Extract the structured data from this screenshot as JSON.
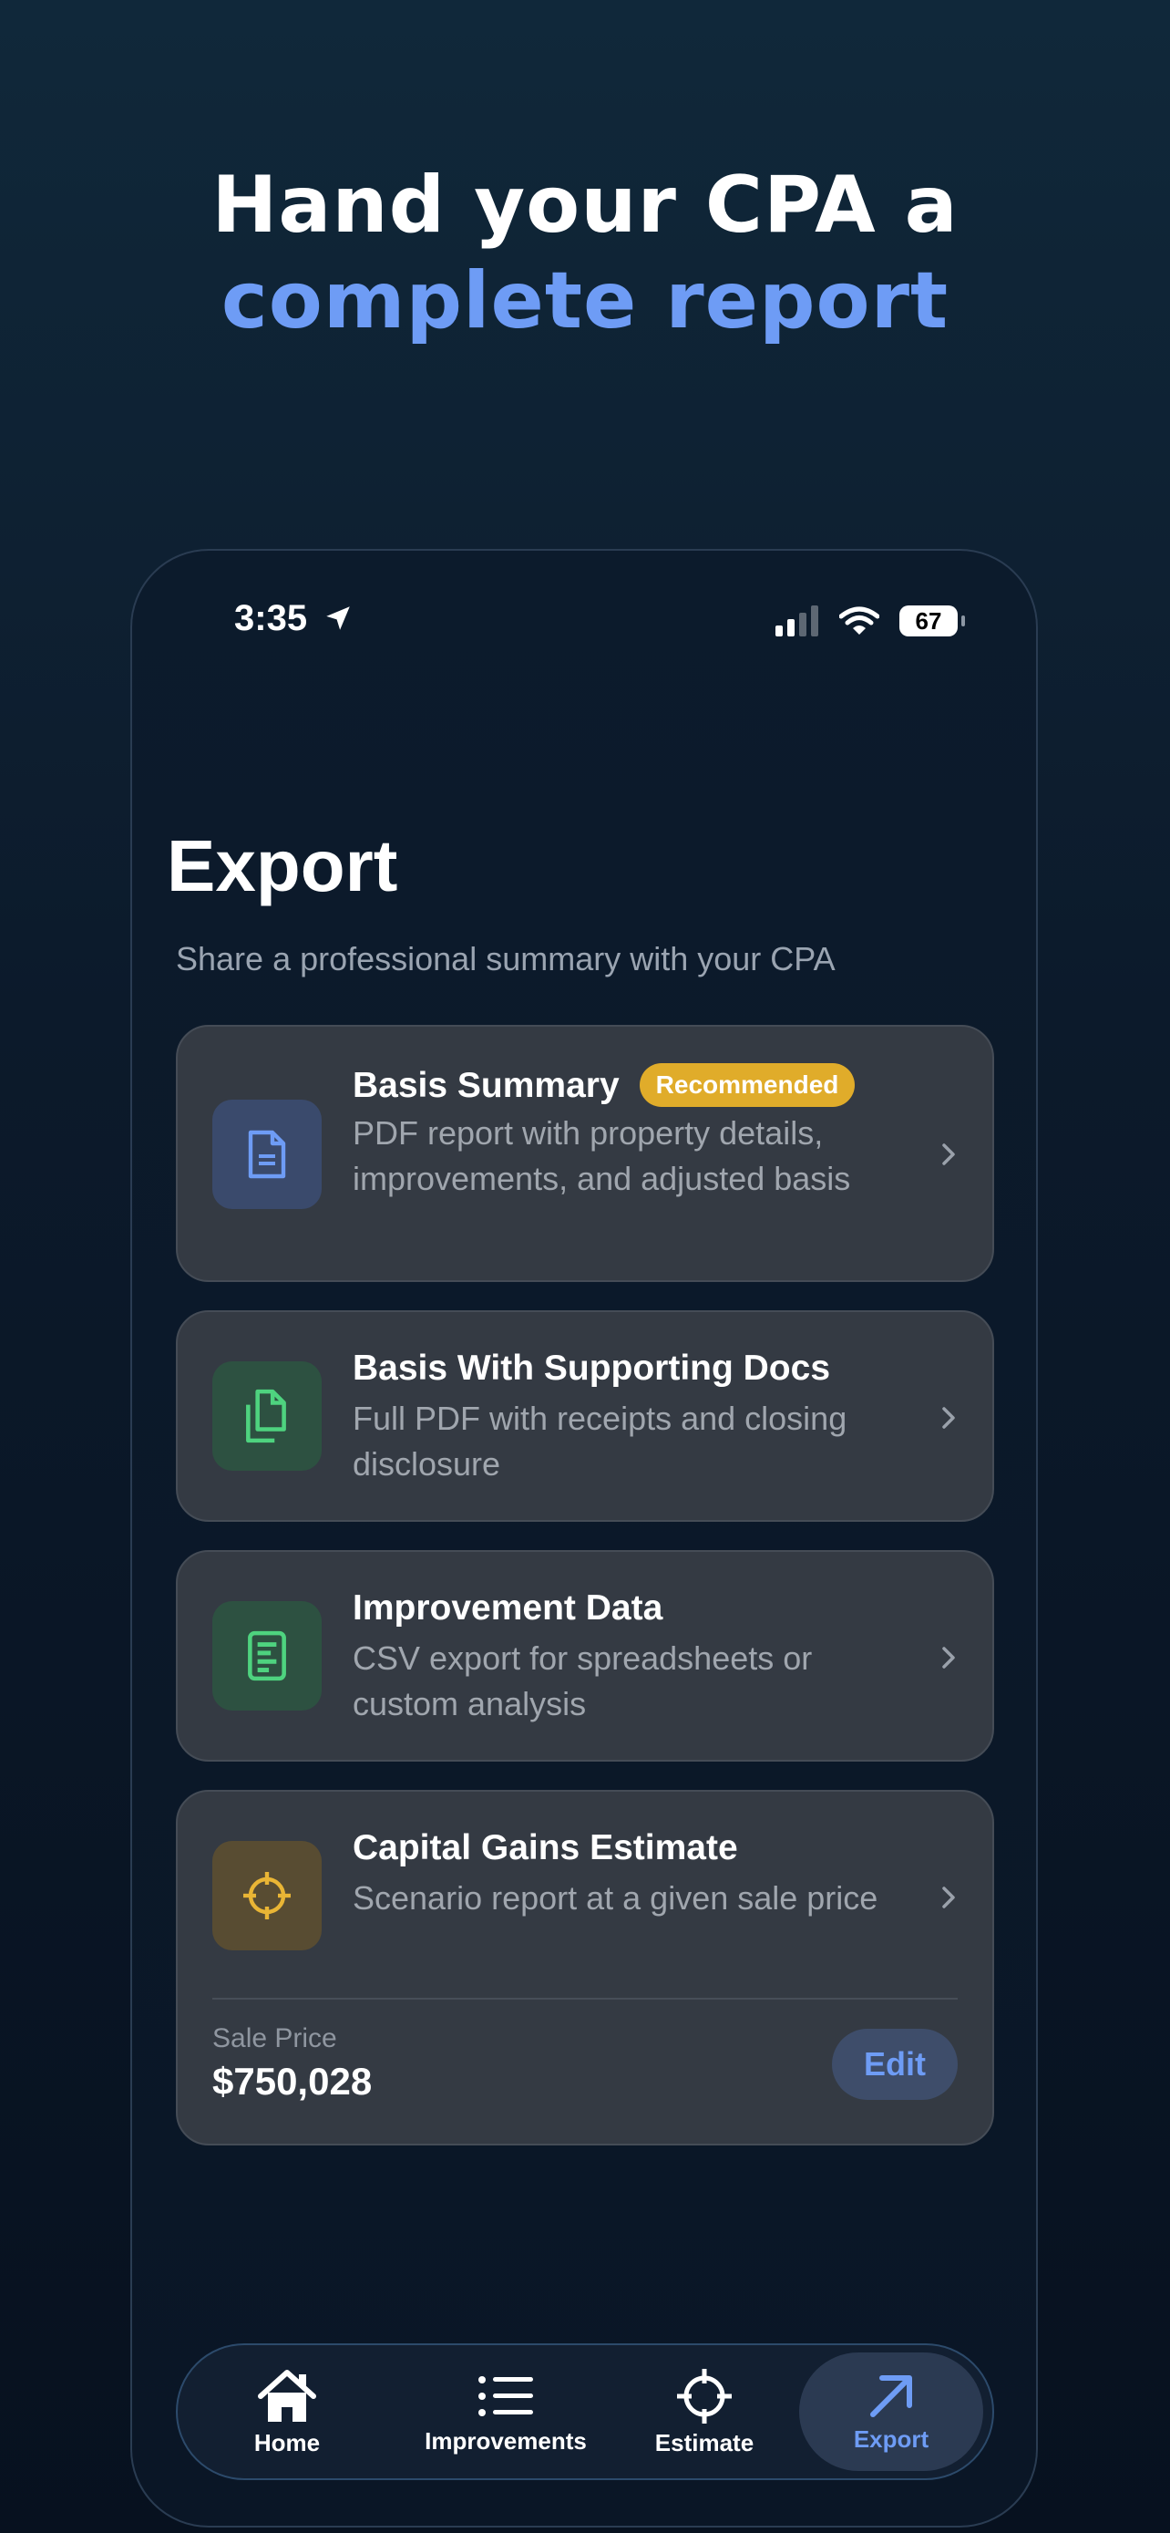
{
  "headline": {
    "line1": "Hand your CPA a",
    "line2": "complete report"
  },
  "status_bar": {
    "time": "3:35",
    "battery": "67"
  },
  "page": {
    "title": "Export",
    "subtitle": "Share a professional summary with your CPA"
  },
  "options": [
    {
      "title": "Basis Summary",
      "badge": "Recommended",
      "desc": "PDF report with property details, improvements, and adjusted basis",
      "icon": "document-icon",
      "color": "#6e9cf5"
    },
    {
      "title": "Basis With Supporting Docs",
      "desc": "Full PDF with receipts and closing disclosure",
      "icon": "documents-icon",
      "color": "#4ed37f"
    },
    {
      "title": "Improvement Data",
      "desc": "CSV export for spreadsheets or custom analysis",
      "icon": "spreadsheet-icon",
      "color": "#4ed37f"
    },
    {
      "title": "Capital Gains Estimate",
      "desc": "Scenario report at a given sale price",
      "icon": "crosshair-icon",
      "color": "#e9b535"
    }
  ],
  "sale": {
    "label": "Sale Price",
    "value": "$750,028",
    "edit_label": "Edit"
  },
  "tabs": [
    {
      "label": "Home",
      "icon": "home-icon"
    },
    {
      "label": "Improvements",
      "icon": "list-icon"
    },
    {
      "label": "Estimate",
      "icon": "crosshair-icon"
    },
    {
      "label": "Export",
      "icon": "arrow-up-right-icon",
      "active": true
    }
  ],
  "colors": {
    "accent": "#6e9cf5",
    "badge": "#e0ac2a",
    "card": "#343a43"
  }
}
